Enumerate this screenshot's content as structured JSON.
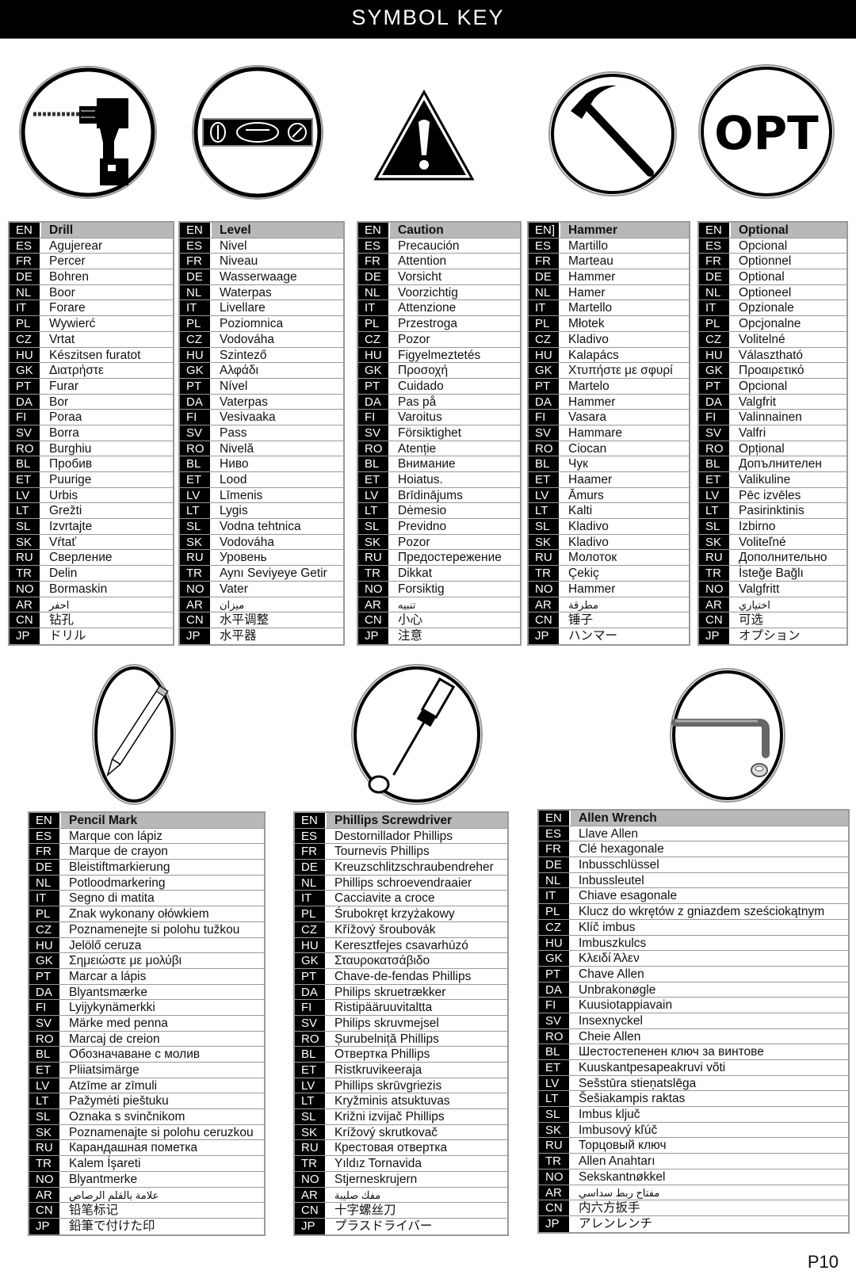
{
  "title": "SYMBOL KEY",
  "page_number": "P10",
  "symbols": [
    {
      "icon": "drill-icon",
      "rows": [
        [
          "EN",
          "Drill"
        ],
        [
          "ES",
          "Agujerear"
        ],
        [
          "FR",
          "Percer"
        ],
        [
          "DE",
          "Bohren"
        ],
        [
          "NL",
          "Boor"
        ],
        [
          "IT",
          "Forare"
        ],
        [
          "PL",
          "Wywierć"
        ],
        [
          "CZ",
          "Vrtat"
        ],
        [
          "HU",
          "Készitsen furatot"
        ],
        [
          "GK",
          "Διατρήστε"
        ],
        [
          "PT",
          "Furar"
        ],
        [
          "DA",
          "Bor"
        ],
        [
          "FI",
          "Poraa"
        ],
        [
          "SV",
          "Borra"
        ],
        [
          "RO",
          "Burghiu"
        ],
        [
          "BL",
          "Пробив"
        ],
        [
          "ET",
          "Puurige"
        ],
        [
          "LV",
          "Urbis"
        ],
        [
          "LT",
          "Grežti"
        ],
        [
          "SL",
          "Izvrtajte"
        ],
        [
          "SK",
          "Vŕtať"
        ],
        [
          "RU",
          "Сверление"
        ],
        [
          "TR",
          "Delin"
        ],
        [
          "NO",
          "Bormaskin"
        ],
        [
          "AR",
          "احفر"
        ],
        [
          "CN",
          "钻孔"
        ],
        [
          "JP",
          "ドリル"
        ]
      ]
    },
    {
      "icon": "level-icon",
      "rows": [
        [
          "EN",
          "Level"
        ],
        [
          "ES",
          "Nivel"
        ],
        [
          "FR",
          "Niveau"
        ],
        [
          "DE",
          "Wasserwaage"
        ],
        [
          "NL",
          "Waterpas"
        ],
        [
          "IT",
          "Livellare"
        ],
        [
          "PL",
          "Poziomnica"
        ],
        [
          "CZ",
          "Vodováha"
        ],
        [
          "HU",
          "Szintező"
        ],
        [
          "GK",
          "Αλφάδι"
        ],
        [
          "PT",
          "Nível"
        ],
        [
          "DA",
          "Vaterpas"
        ],
        [
          "FI",
          "Vesivaaka"
        ],
        [
          "SV",
          "Pass"
        ],
        [
          "RO",
          "Nivelă"
        ],
        [
          "BL",
          "Ниво"
        ],
        [
          "ET",
          "Lood"
        ],
        [
          "LV",
          "Līmenis"
        ],
        [
          "LT",
          "Lygis"
        ],
        [
          "SL",
          "Vodna tehtnica"
        ],
        [
          "SK",
          "Vodováha"
        ],
        [
          "RU",
          "Уровень"
        ],
        [
          "TR",
          "Aynı Seviyeye Getir"
        ],
        [
          "NO",
          "Vater"
        ],
        [
          "AR",
          "ميزان"
        ],
        [
          "CN",
          "水平调整"
        ],
        [
          "JP",
          "水平器"
        ]
      ]
    },
    {
      "icon": "caution-icon",
      "rows": [
        [
          "EN",
          "Caution"
        ],
        [
          "ES",
          "Precaución"
        ],
        [
          "FR",
          "Attention"
        ],
        [
          "DE",
          "Vorsicht"
        ],
        [
          "NL",
          "Voorzichtig"
        ],
        [
          "IT",
          "Attenzione"
        ],
        [
          "PL",
          "Przestroga"
        ],
        [
          "CZ",
          "Pozor"
        ],
        [
          "HU",
          "Figyelmeztetés"
        ],
        [
          "GK",
          "Προσοχή"
        ],
        [
          "PT",
          "Cuidado"
        ],
        [
          "DA",
          "Pas på"
        ],
        [
          "FI",
          "Varoitus"
        ],
        [
          "SV",
          "Försiktighet"
        ],
        [
          "RO",
          "Atenție"
        ],
        [
          "BL",
          "Внимание"
        ],
        [
          "ET",
          "Hoiatus."
        ],
        [
          "LV",
          "Brīdinājums"
        ],
        [
          "LT",
          "Dėmesio"
        ],
        [
          "SL",
          "Previdno"
        ],
        [
          "SK",
          "Pozor"
        ],
        [
          "RU",
          "Предостережение"
        ],
        [
          "TR",
          "Dikkat"
        ],
        [
          "NO",
          "Forsiktig"
        ],
        [
          "AR",
          "تنبيه"
        ],
        [
          "CN",
          "小心"
        ],
        [
          "JP",
          "注意"
        ]
      ]
    },
    {
      "icon": "hammer-icon",
      "rows": [
        [
          "EN]",
          "Hammer"
        ],
        [
          "ES",
          "Martillo"
        ],
        [
          "FR",
          "Marteau"
        ],
        [
          "DE",
          "Hammer"
        ],
        [
          "NL",
          "Hamer"
        ],
        [
          "IT",
          "Martello"
        ],
        [
          "PL",
          "Młotek"
        ],
        [
          "CZ",
          "Kladivo"
        ],
        [
          "HU",
          "Kalapács"
        ],
        [
          "GK",
          "Χτυπήστε με σφυρί"
        ],
        [
          "PT",
          "Martelo"
        ],
        [
          "DA",
          "Hammer"
        ],
        [
          "FI",
          "Vasara"
        ],
        [
          "SV",
          "Hammare"
        ],
        [
          "RO",
          "Ciocan"
        ],
        [
          "BL",
          "Чук"
        ],
        [
          "ET",
          "Haamer"
        ],
        [
          "LV",
          "Āmurs"
        ],
        [
          "LT",
          "Kalti"
        ],
        [
          "SL",
          "Kladivo"
        ],
        [
          "SK",
          "Kladivo"
        ],
        [
          "RU",
          "Молоток"
        ],
        [
          "TR",
          "Çekiç"
        ],
        [
          "NO",
          "Hammer"
        ],
        [
          "AR",
          "مطرقة"
        ],
        [
          "CN",
          "锤子"
        ],
        [
          "JP",
          "ハンマー"
        ]
      ]
    },
    {
      "icon": "optional-icon",
      "icon_text": "OPT",
      "rows": [
        [
          "EN",
          "Optional"
        ],
        [
          "ES",
          "Opcional"
        ],
        [
          "FR",
          "Optionnel"
        ],
        [
          "DE",
          "Optional"
        ],
        [
          "NL",
          "Optioneel"
        ],
        [
          "IT",
          "Opzionale"
        ],
        [
          "PL",
          "Opcjonalne"
        ],
        [
          "CZ",
          "Volitelné"
        ],
        [
          "HU",
          "Választható"
        ],
        [
          "GK",
          "Προαιρετικό"
        ],
        [
          "PT",
          "Opcional"
        ],
        [
          "DA",
          "Valgfrit"
        ],
        [
          "FI",
          "Valinnainen"
        ],
        [
          "SV",
          "Valfri"
        ],
        [
          "RO",
          "Opțional"
        ],
        [
          "BL",
          "Допълнителен"
        ],
        [
          "ET",
          "Valikuline"
        ],
        [
          "LV",
          "Pēc izvēles"
        ],
        [
          "LT",
          "Pasirinktinis"
        ],
        [
          "SL",
          "Izbirno"
        ],
        [
          "SK",
          "Voliteľné"
        ],
        [
          "RU",
          "Дополнительно"
        ],
        [
          "TR",
          "İsteğe Bağlı"
        ],
        [
          "NO",
          "Valgfritt"
        ],
        [
          "AR",
          "اختياري"
        ],
        [
          "CN",
          "可选"
        ],
        [
          "JP",
          "オプション"
        ]
      ]
    },
    {
      "icon": "pencil-icon",
      "rows": [
        [
          "EN",
          "Pencil Mark"
        ],
        [
          "ES",
          "Marque con lápiz"
        ],
        [
          "FR",
          "Marque de crayon"
        ],
        [
          "DE",
          "Bleistiftmarkierung"
        ],
        [
          "NL",
          "Potloodmarkering"
        ],
        [
          "IT",
          "Segno di matita"
        ],
        [
          "PL",
          "Znak wykonany ołówkiem"
        ],
        [
          "CZ",
          "Poznamenejte si polohu tužkou"
        ],
        [
          "HU",
          "Jelölő ceruza"
        ],
        [
          "GK",
          "Σημειώστε με μολύβι"
        ],
        [
          "PT",
          "Marcar a lápis"
        ],
        [
          "DA",
          "Blyantsmærke"
        ],
        [
          "FI",
          "Lyijykynämerkki"
        ],
        [
          "SV",
          "Märke med penna"
        ],
        [
          "RO",
          "Marcaj de creion"
        ],
        [
          "BL",
          "Обозначаване с молив"
        ],
        [
          "ET",
          "Pliiatsimärge"
        ],
        [
          "LV",
          "Atzīme ar zīmuli"
        ],
        [
          "LT",
          "Pažymėti pieštuku"
        ],
        [
          "SL",
          "Oznaka s svinčnikom"
        ],
        [
          "SK",
          "Poznamenajte si polohu ceruzkou"
        ],
        [
          "RU",
          "Карандашная пометка"
        ],
        [
          "TR",
          "Kalem İşareti"
        ],
        [
          "NO",
          "Blyantmerke"
        ],
        [
          "AR",
          "علامة بالقلم الرصاص"
        ],
        [
          "CN",
          "铅笔标记"
        ],
        [
          "JP",
          "鉛筆で付けた印"
        ]
      ]
    },
    {
      "icon": "phillips-screwdriver-icon",
      "rows": [
        [
          "EN",
          "Phillips Screwdriver"
        ],
        [
          "ES",
          "Destornillador Phillips"
        ],
        [
          "FR",
          "Tournevis Phillips"
        ],
        [
          "DE",
          "Kreuzschlitzschraubendreher"
        ],
        [
          "NL",
          "Phillips schroevendraaier"
        ],
        [
          "IT",
          "Cacciavite a croce"
        ],
        [
          "PL",
          "Śrubokręt krzyżakowy"
        ],
        [
          "CZ",
          "Křížový šroubovák"
        ],
        [
          "HU",
          "Keresztfejes csavarhúzó"
        ],
        [
          "GK",
          "Σταυροκατσάβιδο"
        ],
        [
          "PT",
          "Chave-de-fendas Phillips"
        ],
        [
          "DA",
          "Philips skruetrækker"
        ],
        [
          "FI",
          "Ristipääruuvitaltta"
        ],
        [
          "SV",
          "Philips skruvmejsel"
        ],
        [
          "RO",
          "Șurubelniță Phillips"
        ],
        [
          "BL",
          "Отвертка Phillips"
        ],
        [
          "ET",
          "Ristkruvikeeraja"
        ],
        [
          "LV",
          "Phillips skrūvgriezis"
        ],
        [
          "LT",
          "Kryžminis atsuktuvas"
        ],
        [
          "SL",
          "Križni izvijač Phillips"
        ],
        [
          "SK",
          "Krížový skrutkovač"
        ],
        [
          "RU",
          "Крестовая отвертка"
        ],
        [
          "TR",
          "Yıldız Tornavida"
        ],
        [
          "NO",
          "Stjerneskrujern"
        ],
        [
          "AR",
          "مفك صليبة"
        ],
        [
          "CN",
          "十字螺丝刀"
        ],
        [
          "JP",
          "プラスドライバー"
        ]
      ]
    },
    {
      "icon": "allen-wrench-icon",
      "rows": [
        [
          "EN",
          "Allen Wrench"
        ],
        [
          "ES",
          "Llave Allen"
        ],
        [
          "FR",
          "Clé hexagonale"
        ],
        [
          "DE",
          "Inbusschlüssel"
        ],
        [
          "NL",
          "Inbussleutel"
        ],
        [
          "IT",
          "Chiave esagonale"
        ],
        [
          "PL",
          "Klucz do wkrętów z gniazdem sześciokątnym"
        ],
        [
          "CZ",
          "Klíč imbus"
        ],
        [
          "HU",
          "Imbuszkulcs"
        ],
        [
          "GK",
          "Κλειδί Άλεν"
        ],
        [
          "PT",
          "Chave Allen"
        ],
        [
          "DA",
          "Unbrakonøgle"
        ],
        [
          "FI",
          "Kuusiotappiavain"
        ],
        [
          "SV",
          "Insexnyckel"
        ],
        [
          "RO",
          "Cheie Allen"
        ],
        [
          "BL",
          "Шестостепенен ключ за винтове"
        ],
        [
          "ET",
          "Kuuskantpesapeakruvi võti"
        ],
        [
          "LV",
          "Sešstūra stieņatslēga"
        ],
        [
          "LT",
          "Šešiakampis raktas"
        ],
        [
          "SL",
          "Imbus ključ"
        ],
        [
          "SK",
          "Imbusový kľúč"
        ],
        [
          "RU",
          "Торцовый ключ"
        ],
        [
          "TR",
          "Allen Anahtarı"
        ],
        [
          "NO",
          "Sekskantnøkkel"
        ],
        [
          "AR",
          "مفتاح ربط سداسي"
        ],
        [
          "CN",
          "内六方扳手"
        ],
        [
          "JP",
          "アレンレンチ"
        ]
      ]
    }
  ]
}
